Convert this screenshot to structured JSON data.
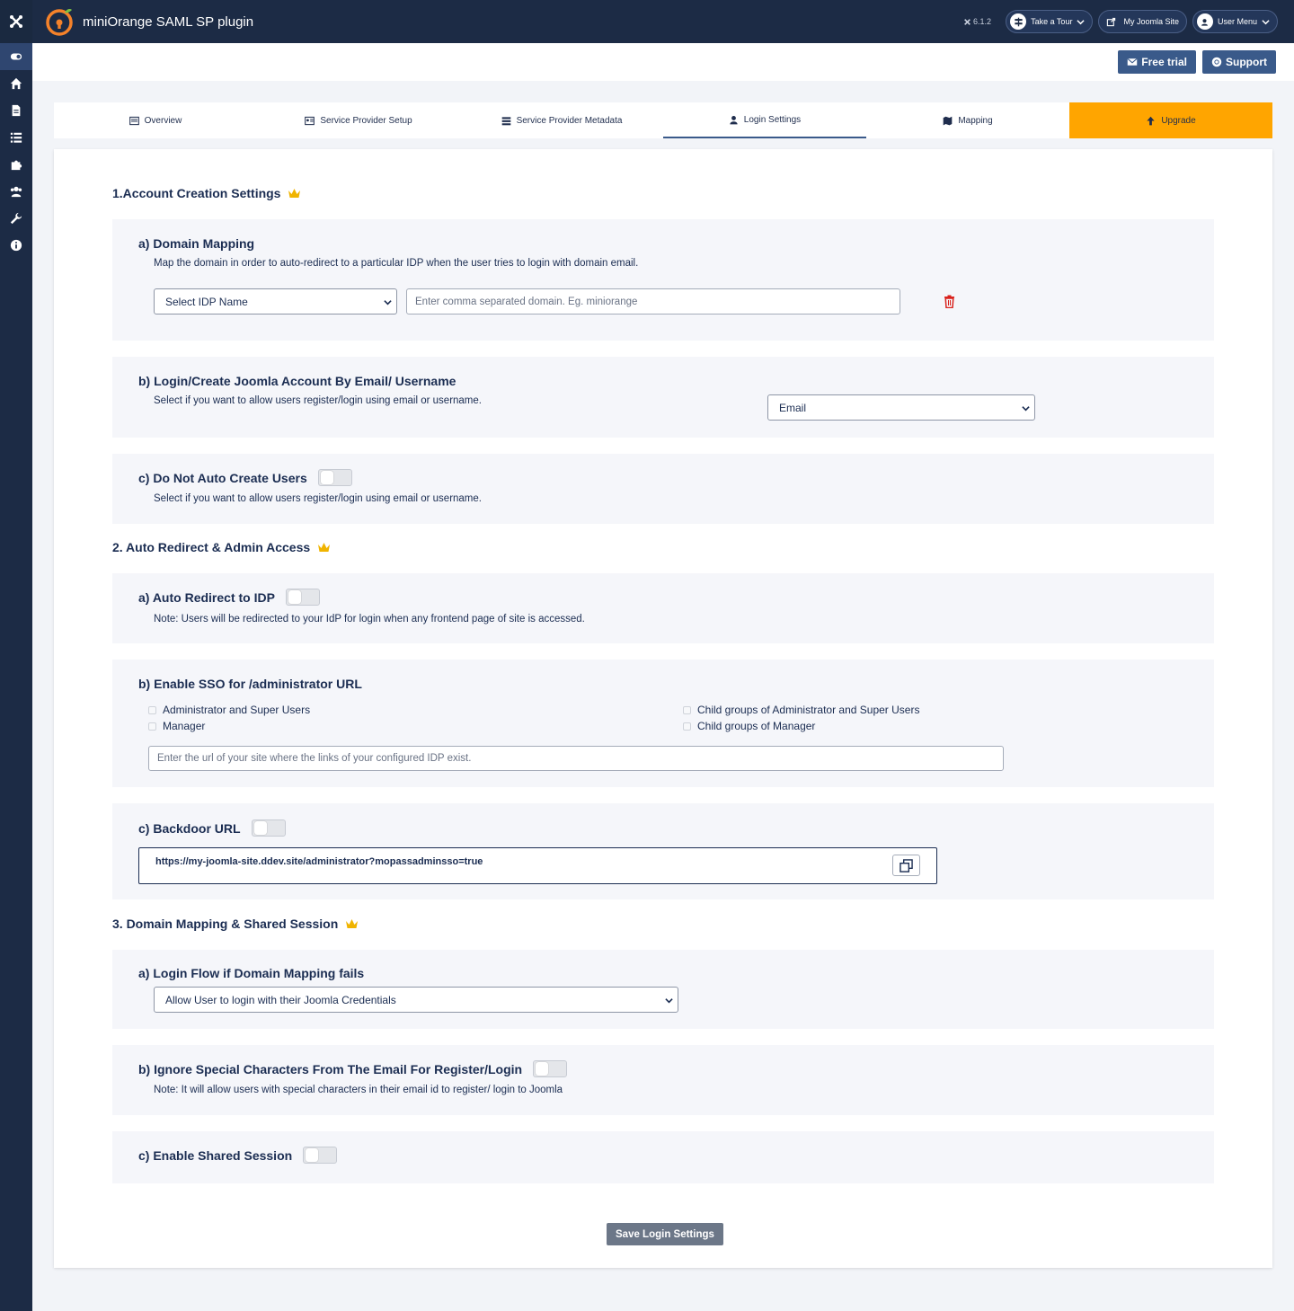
{
  "header": {
    "app_title": "miniOrange SAML SP plugin",
    "version": "6.1.2",
    "take_tour": "Take a Tour",
    "my_site": "My Joomla Site",
    "user_menu": "User Menu"
  },
  "toolbar": {
    "free_trial": "Free trial",
    "support": "Support"
  },
  "tabs": [
    {
      "label": "Overview"
    },
    {
      "label": "Service Provider Setup"
    },
    {
      "label": "Service Provider Metadata"
    },
    {
      "label": "Login Settings"
    },
    {
      "label": "Mapping"
    },
    {
      "label": "Upgrade"
    }
  ],
  "sections": {
    "account": {
      "title": "1.Account Creation Settings",
      "domain_mapping": {
        "heading": "a) Domain Mapping",
        "note": "Map the domain in order to auto-redirect to a particular IDP when the user tries to login with domain email.",
        "idp_select": "Select IDP Name",
        "domain_placeholder": "Enter comma separated domain. Eg. miniorange"
      },
      "login_by": {
        "heading": "b) Login/Create Joomla Account By Email/ Username",
        "note": "Select if you want to allow users register/login using email or username.",
        "selected": "Email"
      },
      "no_auto_create": {
        "heading": "c) Do Not Auto Create Users",
        "note": "Select if you want to allow users register/login using email or username."
      }
    },
    "redirect": {
      "title": "2. Auto Redirect & Admin Access",
      "auto_redirect": {
        "heading": "a) Auto Redirect to IDP",
        "note": "Note: Users will be redirected to your IdP for login when any frontend page of site is accessed."
      },
      "admin_sso": {
        "heading": "b) Enable SSO for /administrator URL",
        "options": [
          "Administrator and Super Users",
          "Manager",
          "Child groups of Administrator and Super Users",
          "Child groups of Manager"
        ],
        "url_placeholder": "Enter the url of your site where the links of your configured IDP exist."
      },
      "backdoor": {
        "heading": "c) Backdoor URL",
        "url": "https://my-joomla-site.ddev.site/administrator?mopassadminsso=true"
      }
    },
    "session": {
      "title": "3. Domain Mapping & Shared Session",
      "login_flow": {
        "heading": "a) Login Flow if Domain Mapping fails",
        "selected": "Allow User to login with their Joomla Credentials"
      },
      "ignore_special": {
        "heading": "b) Ignore Special Characters From The Email For Register/Login",
        "note": "Note: It will allow users with special characters in their email id to register/ login to Joomla"
      },
      "shared_session": {
        "heading": "c) Enable Shared Session"
      }
    }
  },
  "save_label": "Save Login Settings",
  "colors": {
    "navy": "#1c2b45",
    "button_blue": "#3a5a8a",
    "upgrade_orange": "#ffa500",
    "crown_gold": "#f0b400",
    "delete_red": "#d9221c"
  }
}
